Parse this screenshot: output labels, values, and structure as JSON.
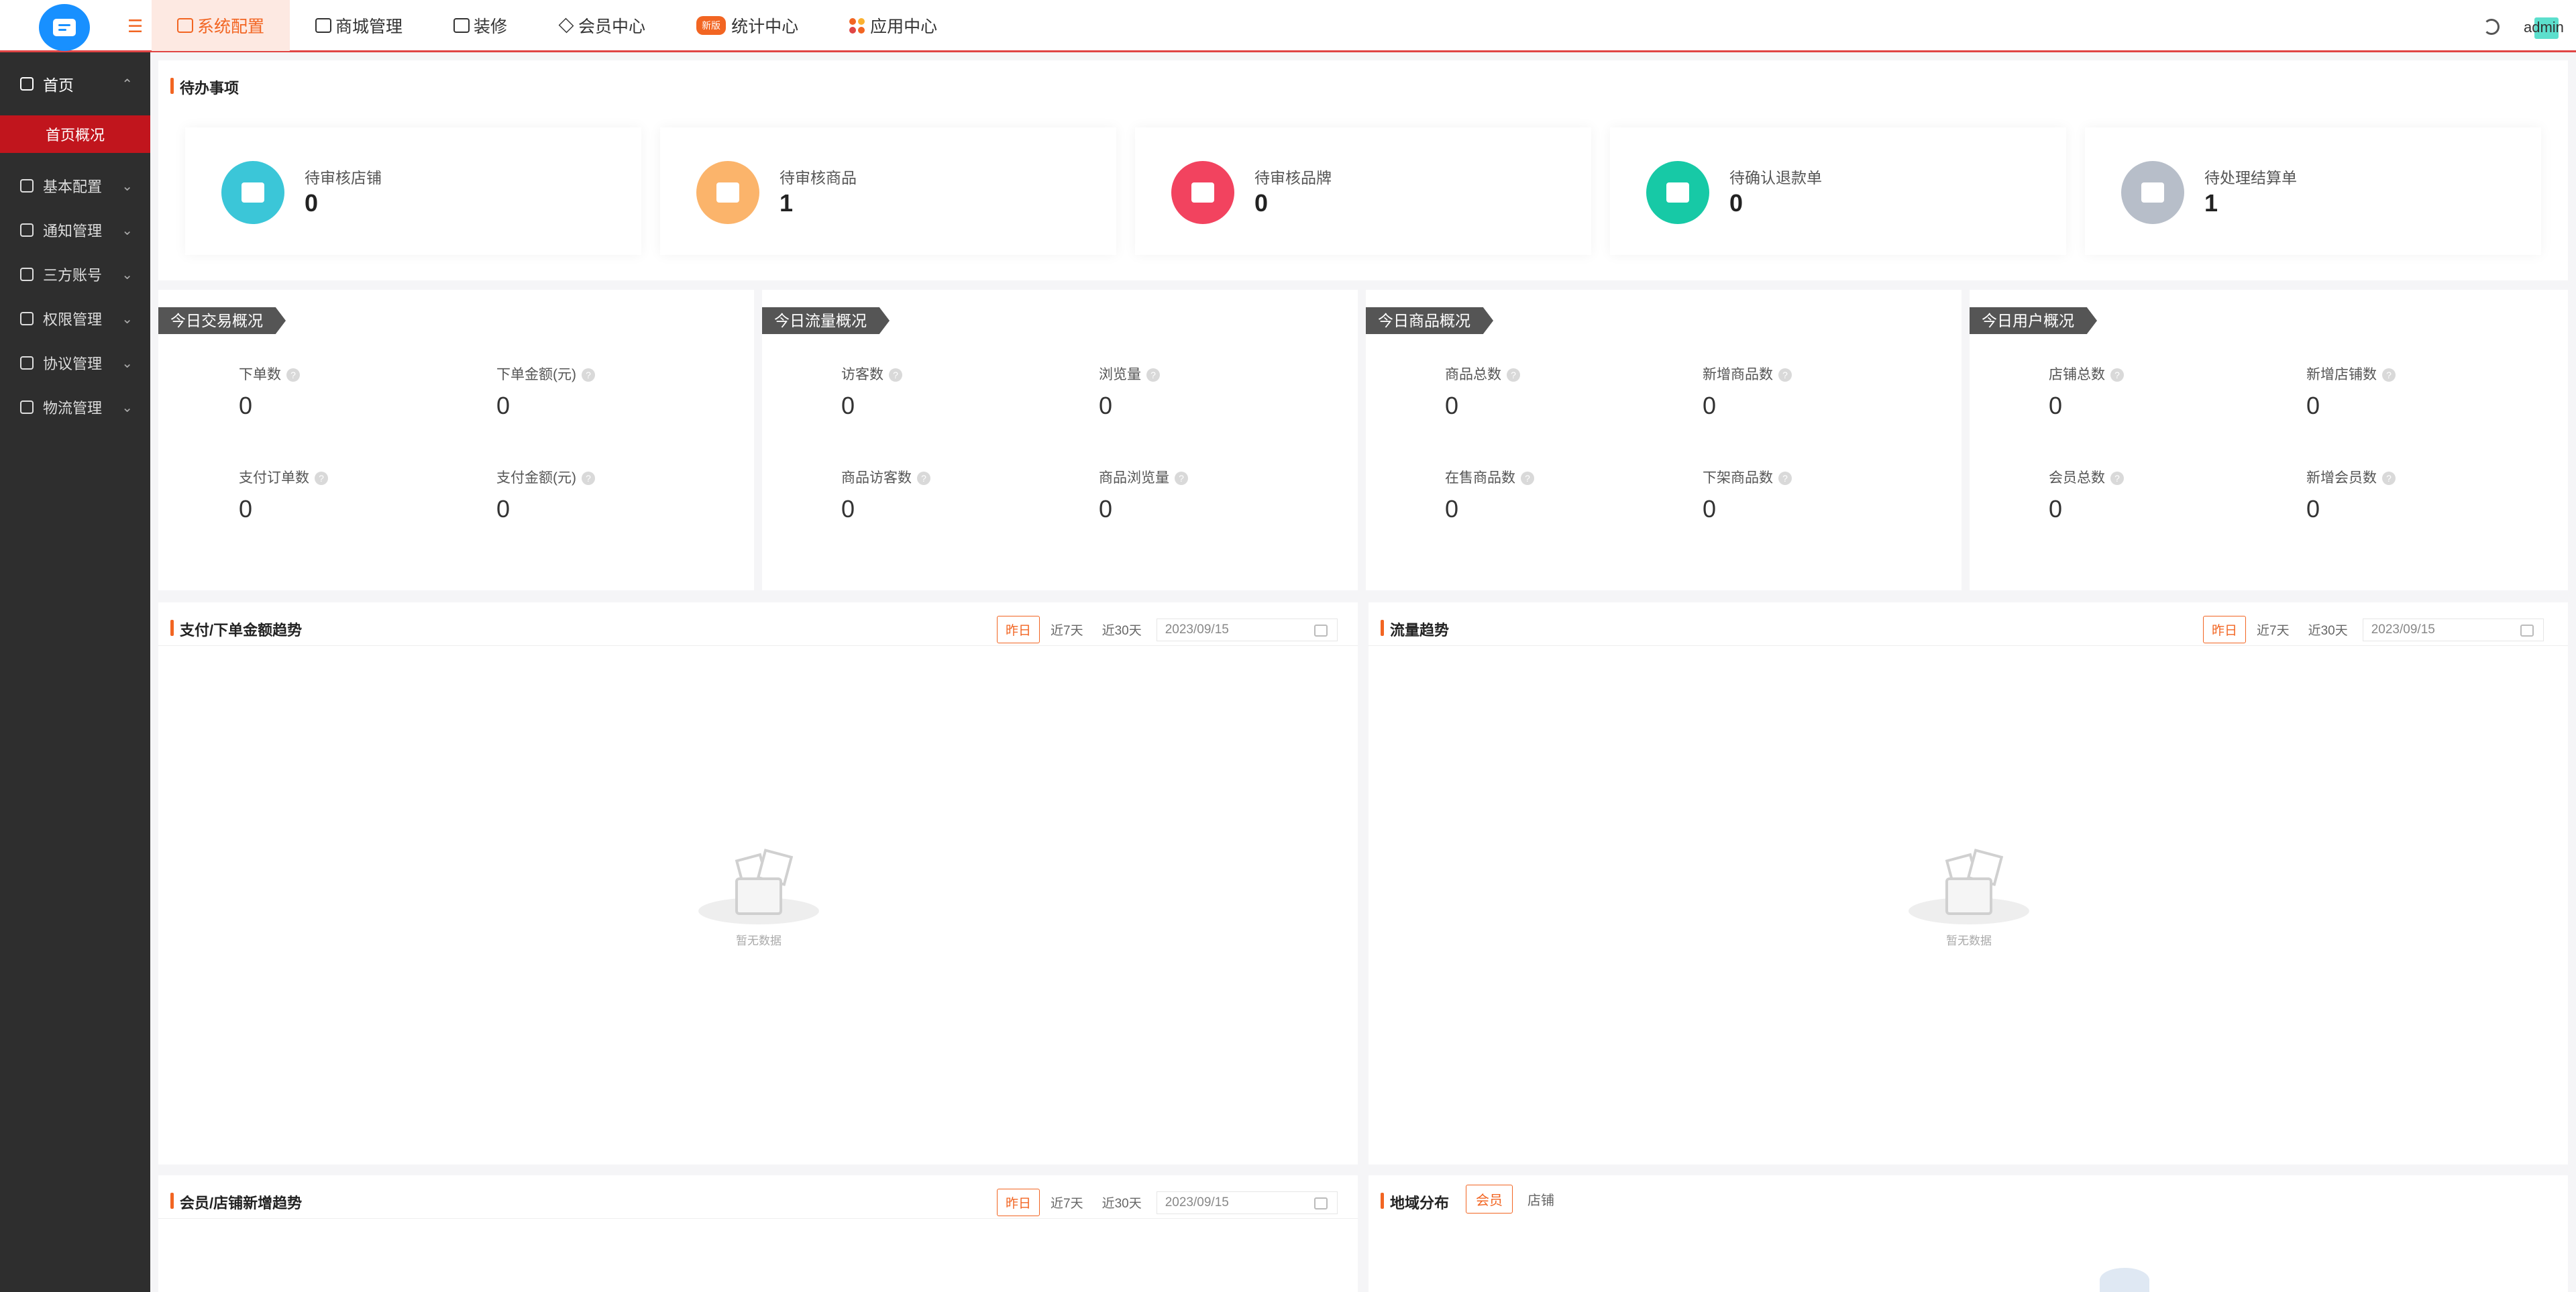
{
  "top_nav": {
    "items": [
      {
        "label": "系统配置"
      },
      {
        "label": "商城管理"
      },
      {
        "label": "装修"
      },
      {
        "label": "会员中心"
      },
      {
        "label": "统计中心",
        "badge": "新版"
      },
      {
        "label": "应用中心"
      }
    ],
    "user": "admin"
  },
  "sidebar": {
    "home": "首页",
    "active_sub": "首页概况",
    "items": [
      "基本配置",
      "通知管理",
      "三方账号",
      "权限管理",
      "协议管理",
      "物流管理"
    ]
  },
  "todo": {
    "title": "待办事项",
    "cards": [
      {
        "label": "待审核店铺",
        "value": "0",
        "color": "#3bc6d8"
      },
      {
        "label": "待审核商品",
        "value": "1",
        "color": "#fbb46b"
      },
      {
        "label": "待审核品牌",
        "value": "0",
        "color": "#f2435f"
      },
      {
        "label": "待确认退款单",
        "value": "0",
        "color": "#17c9a6"
      },
      {
        "label": "待处理结算单",
        "value": "1",
        "color": "#b7bec9"
      }
    ]
  },
  "overviews": [
    {
      "title": "今日交易概况",
      "stats": [
        {
          "label": "下单数",
          "value": "0"
        },
        {
          "label": "下单金额(元)",
          "value": "0"
        },
        {
          "label": "支付订单数",
          "value": "0"
        },
        {
          "label": "支付金额(元)",
          "value": "0"
        }
      ]
    },
    {
      "title": "今日流量概况",
      "stats": [
        {
          "label": "访客数",
          "value": "0"
        },
        {
          "label": "浏览量",
          "value": "0"
        },
        {
          "label": "商品访客数",
          "value": "0"
        },
        {
          "label": "商品浏览量",
          "value": "0"
        }
      ]
    },
    {
      "title": "今日商品概况",
      "stats": [
        {
          "label": "商品总数",
          "value": "0"
        },
        {
          "label": "新增商品数",
          "value": "0"
        },
        {
          "label": "在售商品数",
          "value": "0"
        },
        {
          "label": "下架商品数",
          "value": "0"
        }
      ]
    },
    {
      "title": "今日用户概况",
      "stats": [
        {
          "label": "店铺总数",
          "value": "0"
        },
        {
          "label": "新增店铺数",
          "value": "0"
        },
        {
          "label": "会员总数",
          "value": "0"
        },
        {
          "label": "新增会员数",
          "value": "0"
        }
      ]
    }
  ],
  "ranges": {
    "yesterday": "昨日",
    "d7": "近7天",
    "d30": "近30天",
    "date": "2023/09/15"
  },
  "trends": {
    "pay": "支付/下单金额趋势",
    "flow": "流量趋势",
    "member": "会员/店铺新增趋势",
    "region": "地域分布",
    "region_tabs": [
      "会员",
      "店铺"
    ],
    "empty": "暂无数据"
  },
  "colors": {
    "accent": "#f26522",
    "sidebar_bg": "#2e2e2e",
    "sidebar_active": "#c1151d"
  }
}
